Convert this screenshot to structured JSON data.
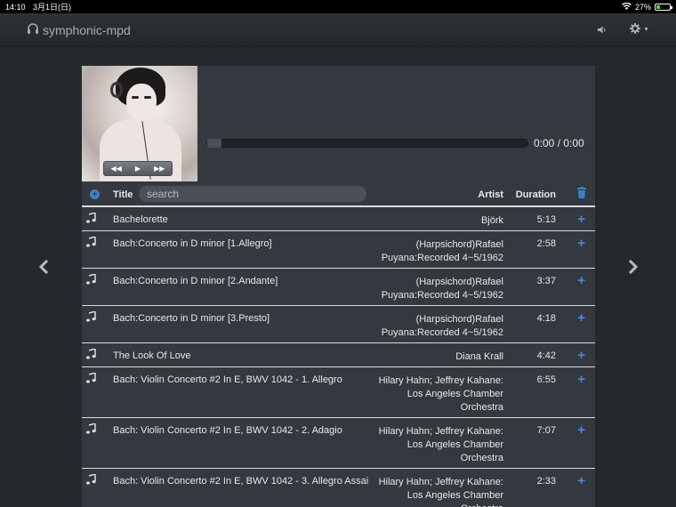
{
  "status_bar": {
    "time": "14:10",
    "date": "3月1日(日)",
    "battery": "27%",
    "battery_level": 0.27
  },
  "navbar": {
    "brand": "symphonic-mpd"
  },
  "player": {
    "time": "0:00 / 0:00",
    "progress": 0
  },
  "table": {
    "title_header": "Title",
    "search_placeholder": "search",
    "artist_header": "Artist",
    "duration_header": "Duration",
    "rows": [
      {
        "title": "Bachelorette",
        "artist": [
          "Björk"
        ],
        "duration": "5:13"
      },
      {
        "title": "Bach:Concerto in D minor [1.Allegro]",
        "artist": [
          "(Harpsichord)Rafael",
          "Puyana:Recorded 4~5/1962"
        ],
        "duration": "2:58"
      },
      {
        "title": "Bach:Concerto in D minor [2.Andante]",
        "artist": [
          "(Harpsichord)Rafael",
          "Puyana:Recorded 4~5/1962"
        ],
        "duration": "3:37"
      },
      {
        "title": "Bach:Concerto in D minor [3.Presto]",
        "artist": [
          "(Harpsichord)Rafael",
          "Puyana:Recorded 4~5/1962"
        ],
        "duration": "4:18"
      },
      {
        "title": "The Look Of Love",
        "artist": [
          "Diana Krall"
        ],
        "duration": "4:42"
      },
      {
        "title": "Bach: Violin Concerto #2 In E, BWV 1042 - 1. Allegro",
        "artist": [
          "Hilary Hahn; Jeffrey Kahane:",
          "Los Angeles Chamber",
          "Orchestra"
        ],
        "duration": "6:55"
      },
      {
        "title": "Bach: Violin Concerto #2 In E, BWV 1042 - 2. Adagio",
        "artist": [
          "Hilary Hahn; Jeffrey Kahane:",
          "Los Angeles Chamber",
          "Orchestra"
        ],
        "duration": "7:07"
      },
      {
        "title": "Bach: Violin Concerto #2 In E, BWV 1042 - 3. Allegro Assai",
        "artist": [
          "Hilary Hahn; Jeffrey Kahane:",
          "Los Angeles Chamber",
          "Orchestra"
        ],
        "duration": "2:33"
      }
    ]
  },
  "icons": {
    "brand": "headphones-icon",
    "volume": "volume-icon",
    "settings": "gear-icon",
    "prev_page": "chevron-left-icon",
    "next_page": "chevron-right-icon",
    "row": "music-note-icon",
    "add": "plus-icon",
    "clear": "trash-icon",
    "add_all": "add-circle-icon"
  },
  "colors": {
    "accent": "#4a8ad4",
    "background": "#25292e",
    "panel": "#34393f"
  }
}
